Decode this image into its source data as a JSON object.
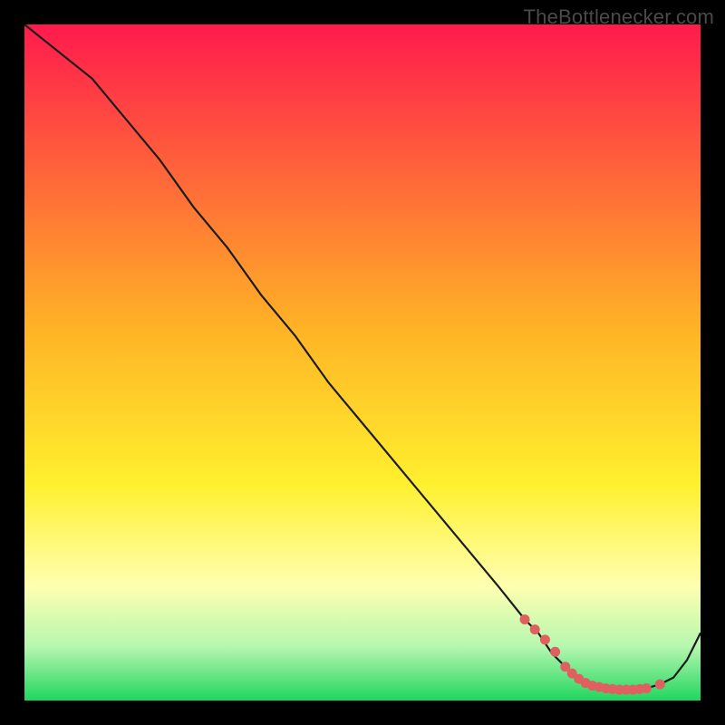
{
  "watermark": "TheBottlenecker.com",
  "colors": {
    "bg_black": "#000000",
    "grad_top": "#ff1a4d",
    "grad_mid_orange": "#ffb326",
    "grad_yellow": "#fff02e",
    "grad_paleyellow": "#ffffb0",
    "grad_green_light": "#b6f7b0",
    "grad_green": "#1fd65f",
    "curve_color": "#1c1c1c",
    "marker_color": "#e06060"
  },
  "chart_data": {
    "type": "line",
    "title": "",
    "xlabel": "",
    "ylabel": "",
    "xlim": [
      0,
      100
    ],
    "ylim": [
      0,
      100
    ],
    "series": [
      {
        "name": "bottleneck-curve",
        "x": [
          0,
          5,
          10,
          15,
          20,
          25,
          30,
          35,
          40,
          45,
          50,
          55,
          60,
          65,
          70,
          74,
          76,
          78,
          80,
          82,
          84,
          86,
          88,
          90,
          92,
          94,
          96,
          98,
          100
        ],
        "y": [
          100,
          96,
          92,
          86,
          80,
          73,
          67,
          60,
          54,
          47,
          41,
          35,
          29,
          23,
          17,
          12,
          10,
          7,
          5,
          3,
          2.2,
          1.8,
          1.6,
          1.6,
          1.8,
          2.4,
          3.4,
          6,
          10
        ]
      }
    ],
    "markers": {
      "name": "highlight-points",
      "x": [
        74,
        75.5,
        77,
        78.5,
        80,
        81,
        82,
        83,
        84,
        85,
        86,
        87,
        88,
        89,
        90,
        91,
        92,
        94
      ],
      "y": [
        12,
        10.5,
        9,
        7.2,
        5,
        4,
        3.2,
        2.6,
        2.2,
        2.0,
        1.8,
        1.7,
        1.6,
        1.6,
        1.6,
        1.7,
        1.8,
        2.4
      ]
    }
  }
}
